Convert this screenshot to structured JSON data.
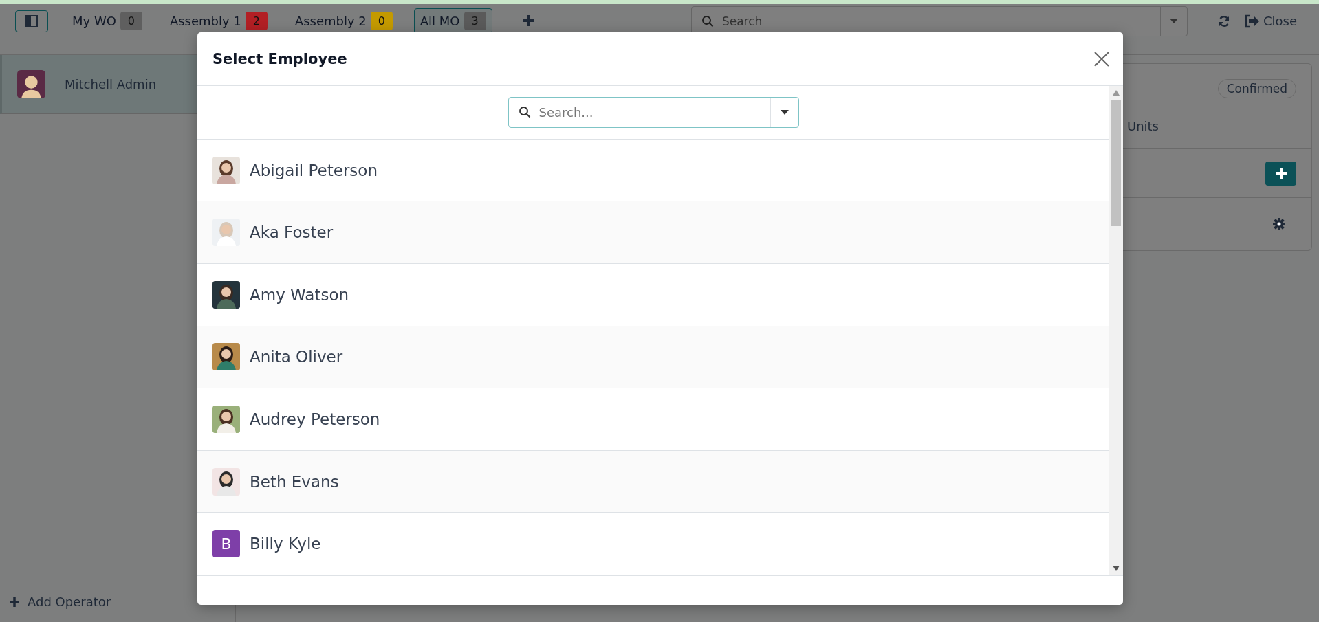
{
  "toolbar": {
    "tabs": [
      {
        "label": "My WO",
        "count": "0",
        "color": "#5f5f5f",
        "selected": false
      },
      {
        "label": "Assembly 1",
        "count": "2",
        "color": "#b21f24",
        "selected": false
      },
      {
        "label": "Assembly 2",
        "count": "0",
        "color": "#c49a00",
        "selected": false
      },
      {
        "label": "All MO",
        "count": "3",
        "color": "#5a5a5a",
        "selected": true
      }
    ],
    "search": {
      "placeholder": "Search"
    },
    "close_label": "Close"
  },
  "sidebar": {
    "operators": [
      {
        "name": "Mitchell Admin",
        "selected": true
      }
    ],
    "add_label": "Add Operator"
  },
  "card": {
    "status": "Confirmed",
    "quantity_text": "Units"
  },
  "dialog": {
    "title": "Select Employee",
    "search": {
      "placeholder": "Search..."
    },
    "employees": [
      {
        "name": "Abigail Peterson",
        "kind": "picture"
      },
      {
        "name": "Aka Foster",
        "kind": "picture"
      },
      {
        "name": "Amy Watson",
        "kind": "picture"
      },
      {
        "name": "Anita Oliver",
        "kind": "picture"
      },
      {
        "name": "Audrey Peterson",
        "kind": "picture"
      },
      {
        "name": "Beth Evans",
        "kind": "picture"
      },
      {
        "name": "Billy Kyle",
        "kind": "initial",
        "initial": "B",
        "color": "#7e3fa8"
      }
    ]
  }
}
